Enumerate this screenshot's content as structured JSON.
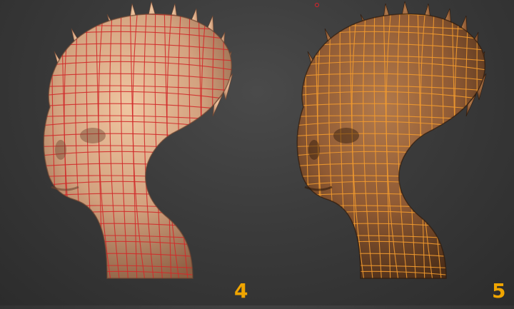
{
  "viewport": {
    "background_color": "#3a3a3a"
  },
  "models": [
    {
      "step_label": "4",
      "skin_color": "#d2a27f",
      "wire_color": "#d22a2a",
      "icon": "sculpt-head-polygroup-wire"
    },
    {
      "step_label": "5",
      "skin_color": "#8f5a34",
      "wire_color": "#f29a2e",
      "icon": "sculpt-head-topology-wire"
    }
  ],
  "label_color": "#f0a500",
  "cursor_icon": "brush-cursor-icon"
}
